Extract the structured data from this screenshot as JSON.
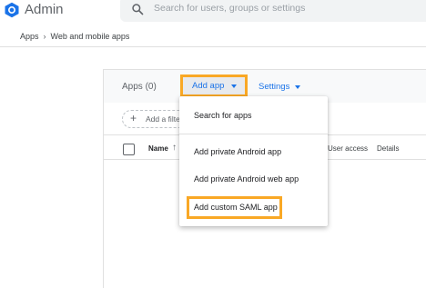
{
  "header": {
    "app_name": "Admin",
    "search_placeholder": "Search for users, groups or settings",
    "logo_icon": "hexagon-logo-icon",
    "brand_color": "#1a73e8"
  },
  "breadcrumb": {
    "items": [
      "Apps",
      "Web and mobile apps"
    ],
    "separator": "›"
  },
  "card": {
    "apps_count_label": "Apps (0)",
    "add_app_label": "Add app",
    "settings_label": "Settings",
    "filter_label": "Add a filte",
    "columns": {
      "name": "Name",
      "user_access": "User access",
      "details": "Details"
    }
  },
  "menu": {
    "items": [
      "Search for apps",
      "Add private Android app",
      "Add private Android web app",
      "Add custom SAML app"
    ]
  },
  "colors": {
    "highlight": "#f9a825",
    "link": "#1a73e8"
  }
}
